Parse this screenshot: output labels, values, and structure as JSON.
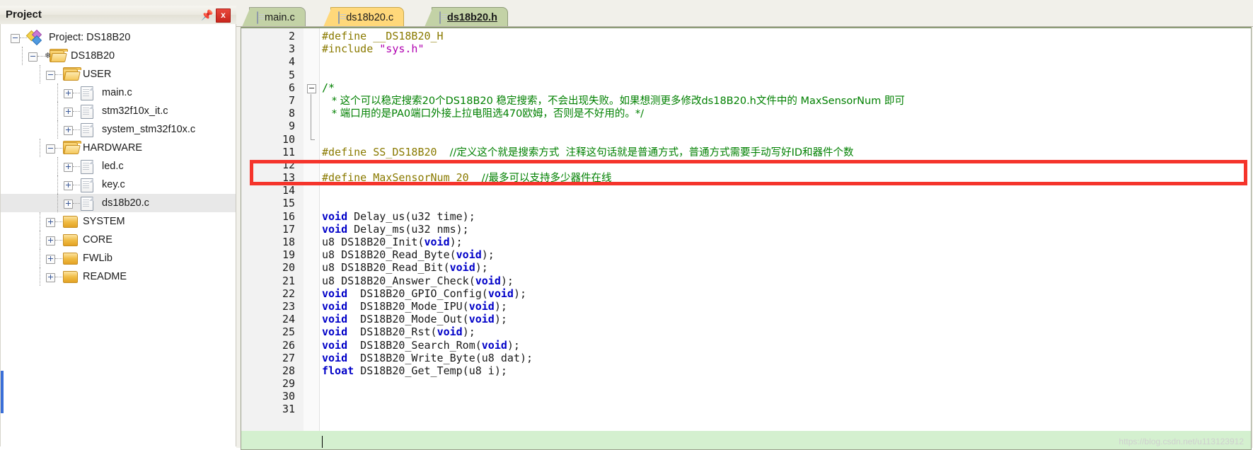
{
  "panel": {
    "title": "Project",
    "pin_icon": "pin-icon",
    "close_label": "x"
  },
  "tree": [
    {
      "id": "project-root",
      "label": "Project: DS18B20",
      "depth": 0,
      "icon": "project-icon",
      "expander": "minus"
    },
    {
      "id": "target-ds18b20",
      "label": "DS18B20",
      "depth": 1,
      "icon": "target-folder-icon",
      "expander": "minus"
    },
    {
      "id": "group-user",
      "label": "USER",
      "depth": 2,
      "icon": "folder-open-icon",
      "expander": "minus"
    },
    {
      "id": "file-main-c",
      "label": "main.c",
      "depth": 3,
      "icon": "file-icon",
      "expander": "plus"
    },
    {
      "id": "file-stm32f10x-it-c",
      "label": "stm32f10x_it.c",
      "depth": 3,
      "icon": "file-icon",
      "expander": "plus"
    },
    {
      "id": "file-system-stm32f10x-c",
      "label": "system_stm32f10x.c",
      "depth": 3,
      "icon": "file-icon",
      "expander": "plus"
    },
    {
      "id": "group-hardware",
      "label": "HARDWARE",
      "depth": 2,
      "icon": "folder-open-icon",
      "expander": "minus"
    },
    {
      "id": "file-led-c",
      "label": "led.c",
      "depth": 3,
      "icon": "file-icon",
      "expander": "plus"
    },
    {
      "id": "file-key-c",
      "label": "key.c",
      "depth": 3,
      "icon": "file-icon",
      "expander": "plus"
    },
    {
      "id": "file-ds18b20-c",
      "label": "ds18b20.c",
      "depth": 3,
      "icon": "file-icon",
      "expander": "plus",
      "selected": true
    },
    {
      "id": "group-system",
      "label": "SYSTEM",
      "depth": 2,
      "icon": "folder-closed-icon",
      "expander": "plus"
    },
    {
      "id": "group-core",
      "label": "CORE",
      "depth": 2,
      "icon": "folder-closed-icon",
      "expander": "plus"
    },
    {
      "id": "group-fwlib",
      "label": "FWLib",
      "depth": 2,
      "icon": "folder-closed-icon",
      "expander": "plus"
    },
    {
      "id": "group-readme",
      "label": "README",
      "depth": 2,
      "icon": "folder-closed-icon",
      "expander": "plus"
    }
  ],
  "tabs": [
    {
      "id": "tab-main-c",
      "label": "main.c",
      "state": "green",
      "active": false
    },
    {
      "id": "tab-ds18b20-c",
      "label": "ds18b20.c",
      "state": "yellow",
      "active": false
    },
    {
      "id": "tab-ds18b20-h",
      "label": "ds18b20.h",
      "state": "green",
      "active": true
    }
  ],
  "code": {
    "first_visible_line": 2,
    "lines": [
      {
        "n": "2",
        "segs": [
          {
            "t": "#define __DS18B20_H",
            "c": "pp"
          }
        ]
      },
      {
        "n": "3",
        "segs": [
          {
            "t": "#include ",
            "c": "pp"
          },
          {
            "t": "\"sys.h\"",
            "c": "str"
          }
        ]
      },
      {
        "n": "4",
        "segs": []
      },
      {
        "n": "5",
        "segs": []
      },
      {
        "n": "6",
        "segs": [
          {
            "t": "/*",
            "c": "cmt"
          }
        ],
        "fold": "start"
      },
      {
        "n": "7",
        "segs": [
          {
            "t": "   * 这个可以稳定搜索20个DS18B20 稳定搜索，不会出现失败。如果想测更多修改ds18B20.h文件中的 MaxSensorNum 即可",
            "c": "cmtcn"
          }
        ],
        "fold": "stem"
      },
      {
        "n": "8",
        "segs": [
          {
            "t": "   * 端口用的是PA0端口外接上拉电阻选470欧姆，否则是不好用的。*/",
            "c": "cmtcn"
          }
        ],
        "fold": "stem"
      },
      {
        "n": "9",
        "segs": [],
        "fold": "stem"
      },
      {
        "n": "10",
        "segs": [],
        "fold": "end"
      },
      {
        "n": "11",
        "segs": [
          {
            "t": "#define SS_DS18B20  ",
            "c": "pp"
          },
          {
            "t": "//定义这个就是搜索方式  注释这句话就是普通方式，普通方式需要手动写好ID和器件个数",
            "c": "cmtcn"
          }
        ]
      },
      {
        "n": "12",
        "segs": []
      },
      {
        "n": "13",
        "segs": [
          {
            "t": "#define MaxSensorNum 20  ",
            "c": "pp"
          },
          {
            "t": "//最多可以支持多少器件在线",
            "c": "cmtcn"
          }
        ]
      },
      {
        "n": "14",
        "segs": []
      },
      {
        "n": "15",
        "segs": []
      },
      {
        "n": "16",
        "segs": [
          {
            "t": "void ",
            "c": "kw"
          },
          {
            "t": "Delay_us(u32 time);",
            "c": "plain"
          }
        ]
      },
      {
        "n": "17",
        "segs": [
          {
            "t": "void ",
            "c": "kw"
          },
          {
            "t": "Delay_ms(u32 nms);",
            "c": "plain"
          }
        ]
      },
      {
        "n": "18",
        "segs": [
          {
            "t": "u8 DS18B20_Init(",
            "c": "plain"
          },
          {
            "t": "void",
            "c": "kw"
          },
          {
            "t": ");",
            "c": "plain"
          }
        ]
      },
      {
        "n": "19",
        "segs": [
          {
            "t": "u8 DS18B20_Read_Byte(",
            "c": "plain"
          },
          {
            "t": "void",
            "c": "kw"
          },
          {
            "t": ");",
            "c": "plain"
          }
        ]
      },
      {
        "n": "20",
        "segs": [
          {
            "t": "u8 DS18B20_Read_Bit(",
            "c": "plain"
          },
          {
            "t": "void",
            "c": "kw"
          },
          {
            "t": ");",
            "c": "plain"
          }
        ]
      },
      {
        "n": "21",
        "segs": [
          {
            "t": "u8 DS18B20_Answer_Check(",
            "c": "plain"
          },
          {
            "t": "void",
            "c": "kw"
          },
          {
            "t": ");",
            "c": "plain"
          }
        ]
      },
      {
        "n": "22",
        "segs": [
          {
            "t": "void ",
            "c": "kw"
          },
          {
            "t": " DS18B20_GPIO_Config(",
            "c": "plain"
          },
          {
            "t": "void",
            "c": "kw"
          },
          {
            "t": ");",
            "c": "plain"
          }
        ]
      },
      {
        "n": "23",
        "segs": [
          {
            "t": "void ",
            "c": "kw"
          },
          {
            "t": " DS18B20_Mode_IPU(",
            "c": "plain"
          },
          {
            "t": "void",
            "c": "kw"
          },
          {
            "t": ");",
            "c": "plain"
          }
        ]
      },
      {
        "n": "24",
        "segs": [
          {
            "t": "void ",
            "c": "kw"
          },
          {
            "t": " DS18B20_Mode_Out(",
            "c": "plain"
          },
          {
            "t": "void",
            "c": "kw"
          },
          {
            "t": ");",
            "c": "plain"
          }
        ]
      },
      {
        "n": "25",
        "segs": [
          {
            "t": "void ",
            "c": "kw"
          },
          {
            "t": " DS18B20_Rst(",
            "c": "plain"
          },
          {
            "t": "void",
            "c": "kw"
          },
          {
            "t": ");",
            "c": "plain"
          }
        ]
      },
      {
        "n": "26",
        "segs": [
          {
            "t": "void ",
            "c": "kw"
          },
          {
            "t": " DS18B20_Search_Rom(",
            "c": "plain"
          },
          {
            "t": "void",
            "c": "kw"
          },
          {
            "t": ");",
            "c": "plain"
          }
        ]
      },
      {
        "n": "27",
        "segs": [
          {
            "t": "void ",
            "c": "kw"
          },
          {
            "t": " DS18B20_Write_Byte(u8 dat);",
            "c": "plain"
          }
        ]
      },
      {
        "n": "28",
        "segs": [
          {
            "t": "float ",
            "c": "kw"
          },
          {
            "t": "DS18B20_Get_Temp(u8 i);",
            "c": "plain"
          }
        ]
      },
      {
        "n": "29",
        "segs": []
      },
      {
        "n": "30",
        "segs": []
      },
      {
        "n": "31",
        "segs": []
      }
    ],
    "highlight_box_color": "#f5342b"
  },
  "watermark": "https://blog.csdn.net/u113123912"
}
